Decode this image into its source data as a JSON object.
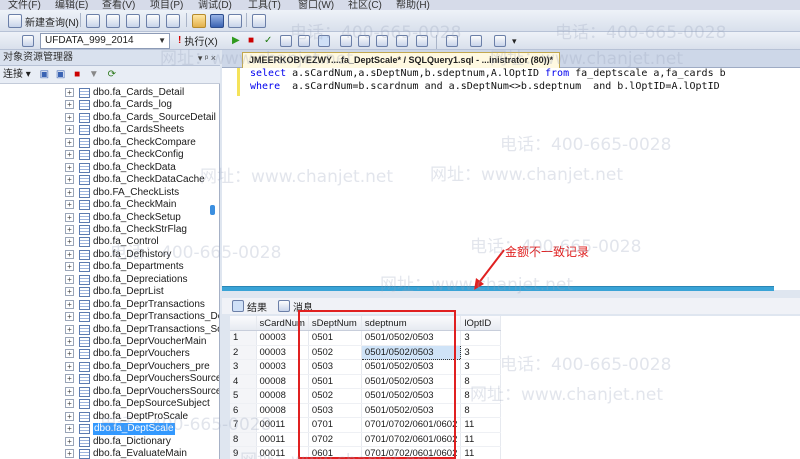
{
  "menu": [
    "文件(F)",
    "编辑(E)",
    "查看(V)",
    "项目(P)",
    "调试(D)",
    "工具(T)",
    "窗口(W)",
    "社区(C)",
    "帮助(H)"
  ],
  "toolbar": {
    "new_query_label": "新建查询(N)",
    "database": "UFDATA_999_2014",
    "execute_label": "执行(X)"
  },
  "object_explorer": {
    "title": "对象资源管理器",
    "pin_glyphs": "▾ ᵖ ×",
    "connect_label": "连接 ▾",
    "items": [
      "dbo.fa_Cards_Detail",
      "dbo.fa_Cards_log",
      "dbo.fa_Cards_SourceDetail",
      "dbo.fa_CardsSheets",
      "dbo.fa_CheckCompare",
      "dbo.fa_CheckConfig",
      "dbo.fa_CheckData",
      "dbo.fa_CheckDataCache",
      "dbo.FA_CheckLists",
      "dbo.fa_CheckMain",
      "dbo.fa_CheckSetup",
      "dbo.fa_CheckStrFlag",
      "dbo.fa_Control",
      "dbo.fa_Defhistory",
      "dbo.fa_Departments",
      "dbo.fa_Depreciations",
      "dbo.fa_DeprList",
      "dbo.fa_DeprTransactions",
      "dbo.fa_DeprTransactions_De",
      "dbo.fa_DeprTransactions_So",
      "dbo.fa_DeprVoucherMain",
      "dbo.fa_DeprVouchers",
      "dbo.fa_DeprVouchers_pre",
      "dbo.fa_DeprVouchersSource",
      "dbo.fa_DeprVouchersSource",
      "dbo.fa_DepSourceSubject",
      "dbo.fa_DeptProScale",
      "dbo.fa_DeptScale",
      "dbo.fa_Dictionary",
      "dbo.fa_EvaluateMain"
    ],
    "selected_index": 27
  },
  "editor": {
    "tab_label": "JMEERKOBYEZWY....fa_DeptScale* / SQLQuery1.sql - ...inistrator (80))*",
    "line1": {
      "kw1": "select",
      "body": " a.sCardNum,a.sDeptNum,b.sdeptnum,A.lOptID ",
      "kw2": "from",
      "tail": " fa_deptscale a,fa_cards b"
    },
    "line2": {
      "kw1": "where",
      "body": "  a.sCardNum=b.scardnum and a.sDeptNum<>b.sdeptnum  and b.lOptID=A.lOptID"
    }
  },
  "annotation": {
    "text": "金额不一致记录",
    "color": "#e02020"
  },
  "results": {
    "tabs": [
      "结果",
      "消息"
    ],
    "columns": [
      "",
      "sCardNum",
      "sDeptNum",
      "sdeptnum",
      "lOptID"
    ],
    "rows": [
      [
        "1",
        "00003",
        "0501",
        "0501/0502/0503",
        "3"
      ],
      [
        "2",
        "00003",
        "0502",
        "0501/0502/0503",
        "3"
      ],
      [
        "3",
        "00003",
        "0503",
        "0501/0502/0503",
        "3"
      ],
      [
        "4",
        "00008",
        "0501",
        "0501/0502/0503",
        "8"
      ],
      [
        "5",
        "00008",
        "0502",
        "0501/0502/0503",
        "8"
      ],
      [
        "6",
        "00008",
        "0503",
        "0501/0502/0503",
        "8"
      ],
      [
        "7",
        "00011",
        "0701",
        "0701/0702/0601/0602",
        "11"
      ],
      [
        "8",
        "00011",
        "0702",
        "0701/0702/0601/0602",
        "11"
      ],
      [
        "9",
        "00011",
        "0601",
        "0701/0702/0601/0602",
        "11"
      ]
    ],
    "highlight_cell": [
      1,
      3
    ]
  },
  "watermark": {
    "phone": "电话：400-665-0028",
    "site": "网址：www.chanjet.net"
  }
}
